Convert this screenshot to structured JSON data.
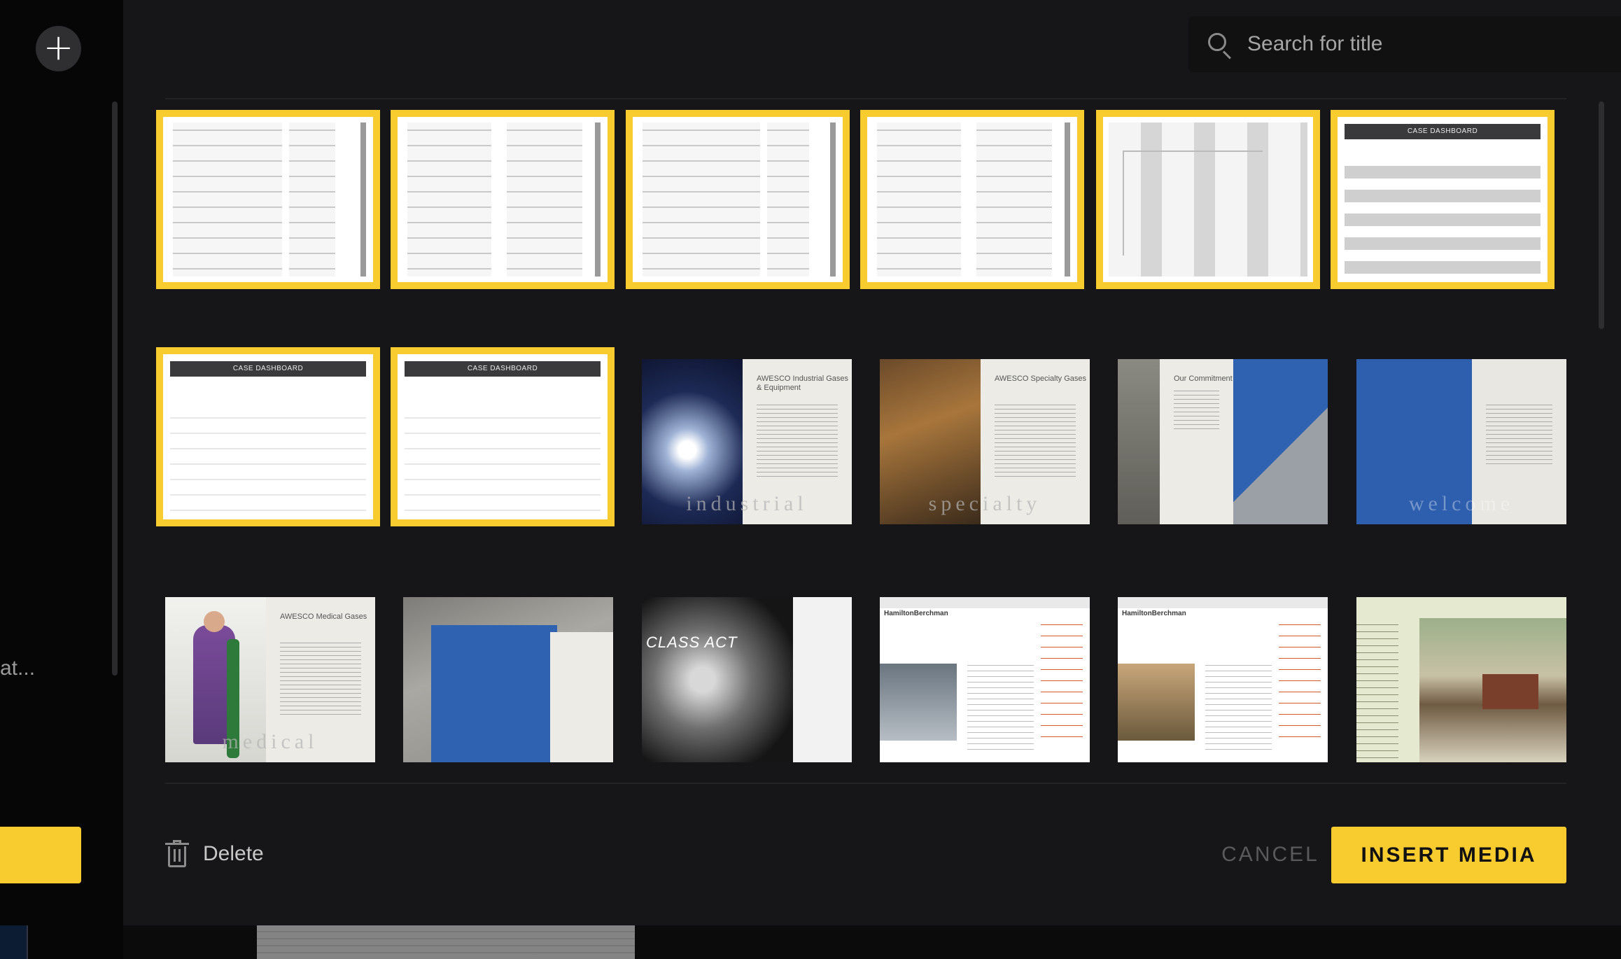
{
  "search": {
    "placeholder": "Search for title"
  },
  "sidebar": {
    "truncated_label": "at..."
  },
  "thumbnails": [
    {
      "kind": "form",
      "selected": true
    },
    {
      "kind": "form",
      "selected": true
    },
    {
      "kind": "form",
      "selected": true
    },
    {
      "kind": "form",
      "selected": true
    },
    {
      "kind": "wireframe",
      "selected": true
    },
    {
      "kind": "dashboard",
      "selected": true,
      "header": "CASE DASHBOARD"
    },
    {
      "kind": "dashboard",
      "selected": true,
      "header": "CASE DASHBOARD"
    },
    {
      "kind": "dashboard",
      "selected": true,
      "header": "CASE DASHBOARD"
    },
    {
      "kind": "brochure",
      "selected": false,
      "heading": "AWESCO Industrial Gases & Equipment",
      "watermark": "industrial"
    },
    {
      "kind": "brochure",
      "selected": false,
      "heading": "AWESCO Specialty Gases",
      "watermark": "specialty"
    },
    {
      "kind": "brochure",
      "selected": false,
      "heading": "Our Commitment",
      "watermark": ""
    },
    {
      "kind": "brochure",
      "selected": false,
      "heading": "",
      "watermark": "welcome"
    },
    {
      "kind": "brochure",
      "selected": false,
      "heading": "AWESCO Medical Gases",
      "watermark": "medical"
    },
    {
      "kind": "folder",
      "selected": false
    },
    {
      "kind": "brochure",
      "selected": false,
      "heading": "CLASS ACT",
      "watermark": ""
    },
    {
      "kind": "website",
      "selected": false,
      "brand": "HamiltonBerchman"
    },
    {
      "kind": "website",
      "selected": false,
      "brand": "HamiltonBerchman"
    },
    {
      "kind": "website",
      "selected": false,
      "brand": ""
    }
  ],
  "footer": {
    "delete_label": "Delete",
    "cancel_label": "CANCEL",
    "insert_label": "INSERT MEDIA"
  },
  "colors": {
    "accent": "#f8cb2e",
    "modal_bg": "#161618",
    "page_bg": "#0b0b0c"
  }
}
